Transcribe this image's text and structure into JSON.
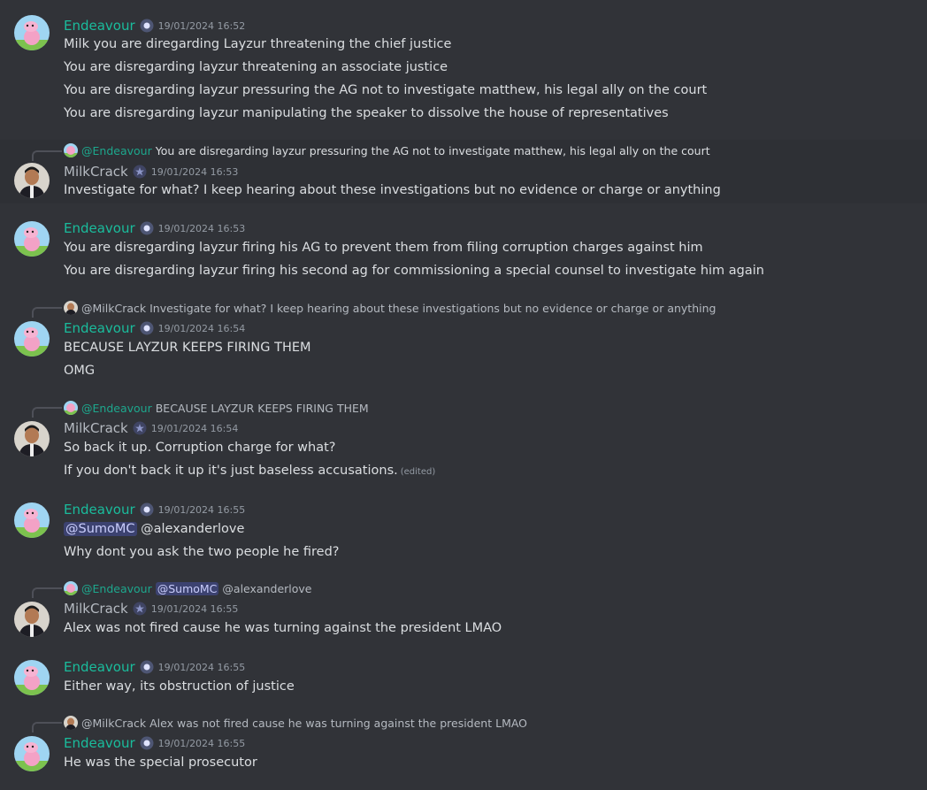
{
  "users": {
    "endeavour": {
      "name": "Endeavour",
      "color": "#1abc9c",
      "badge_icon": "shield-badge-icon"
    },
    "milkcrack": {
      "name": "MilkCrack",
      "color": "#b5bac1",
      "badge_icon": "star-badge-icon"
    }
  },
  "messages": [
    {
      "author": "Endeavour",
      "timestamp": "19/01/2024 16:52",
      "lines": [
        "Milk you are diregarding Layzur threatening the chief justice",
        "You are disregarding layzur threatening an associate justice",
        "You are disregarding layzur pressuring the AG not to investigate matthew, his legal ally on the court",
        "You are disregarding layzur manipulating the speaker to dissolve the house of representatives"
      ]
    },
    {
      "author": "MilkCrack",
      "timestamp": "19/01/2024 16:53",
      "reply": {
        "mention": "@Endeavour",
        "text": "You are disregarding layzur pressuring the AG not to investigate matthew, his legal ally on the court"
      },
      "lines": [
        "Investigate for what? I keep hearing about these investigations but no evidence or charge or anything"
      ]
    },
    {
      "author": "Endeavour",
      "timestamp": "19/01/2024 16:53",
      "lines": [
        "You are disregarding layzur firing his AG to prevent them from filing corruption charges against him",
        "You are disregarding layzur firing his second ag for commissioning a special counsel to investigate him again"
      ]
    },
    {
      "author": "Endeavour",
      "timestamp": "19/01/2024 16:54",
      "reply": {
        "mention": "@MilkCrack",
        "text": "Investigate for what? I keep hearing about these investigations but no evidence or charge or anything"
      },
      "lines": [
        "BECAUSE LAYZUR KEEPS FIRING THEM",
        "OMG"
      ]
    },
    {
      "author": "MilkCrack",
      "timestamp": "19/01/2024 16:54",
      "reply": {
        "mention": "@Endeavour",
        "text": "BECAUSE LAYZUR KEEPS FIRING THEM"
      },
      "lines": [
        "So back it up. Corruption charge for what?",
        "If you don't back it up it's just baseless accusations."
      ],
      "edited": "(edited)"
    },
    {
      "author": "Endeavour",
      "timestamp": "19/01/2024 16:55",
      "lines_mention": {
        "mention": "@SumoMC",
        "text": "@alexanderlove"
      },
      "lines": [
        "Why dont you ask the two people he fired?"
      ]
    },
    {
      "author": "MilkCrack",
      "timestamp": "19/01/2024 16:55",
      "reply": {
        "mention": "@Endeavour",
        "inner_mention": "@SumoMC",
        "text": "@alexanderlove"
      },
      "lines": [
        "Alex was not fired cause he was turning against the president LMAO"
      ]
    },
    {
      "author": "Endeavour",
      "timestamp": "19/01/2024 16:55",
      "lines": [
        "Either way, its obstruction of justice"
      ]
    },
    {
      "author": "Endeavour",
      "timestamp": "19/01/2024 16:55",
      "reply": {
        "mention": "@MilkCrack",
        "text": "Alex was not fired cause he was turning against the president LMAO"
      },
      "lines": [
        "He was the special prosecutor"
      ]
    }
  ]
}
